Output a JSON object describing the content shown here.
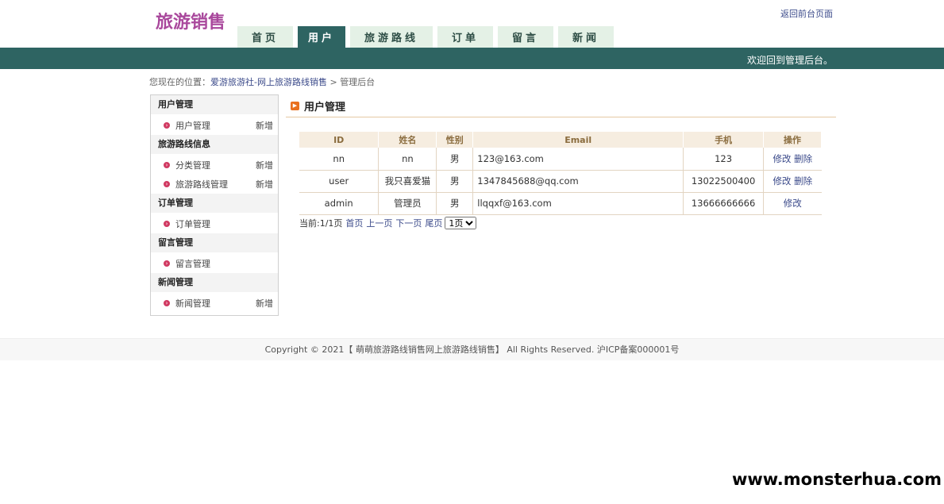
{
  "header": {
    "logo": "旅游销售",
    "back_link": "返回前台页面",
    "welcome": "欢迎回到管理后台。"
  },
  "nav": {
    "tabs": [
      {
        "label": "首页",
        "active": false
      },
      {
        "label": "用户",
        "active": true
      },
      {
        "label": "旅游路线",
        "active": false
      },
      {
        "label": "订单",
        "active": false
      },
      {
        "label": "留言",
        "active": false
      },
      {
        "label": "新闻",
        "active": false
      }
    ]
  },
  "breadcrumb": {
    "prefix": "您现在的位置：",
    "site": "爱游旅游社-网上旅游路线销售",
    "separator": ">",
    "current": "管理后台"
  },
  "sidebar": {
    "sections": [
      {
        "title": "用户管理",
        "items": [
          {
            "label": "用户管理",
            "add": "新增"
          }
        ]
      },
      {
        "title": "旅游路线信息",
        "items": [
          {
            "label": "分类管理",
            "add": "新增"
          },
          {
            "label": "旅游路线管理",
            "add": "新增"
          }
        ]
      },
      {
        "title": "订单管理",
        "items": [
          {
            "label": "订单管理",
            "add": ""
          }
        ]
      },
      {
        "title": "留言管理",
        "items": [
          {
            "label": "留言管理",
            "add": ""
          }
        ]
      },
      {
        "title": "新闻管理",
        "items": [
          {
            "label": "新闻管理",
            "add": "新增"
          }
        ]
      }
    ]
  },
  "main": {
    "title": "用户管理",
    "table": {
      "headers": [
        "ID",
        "姓名",
        "性别",
        "Email",
        "手机",
        "操作"
      ],
      "rows": [
        {
          "id": "nn",
          "name": "nn",
          "gender": "男",
          "email": "123@163.com",
          "phone": "123",
          "edit": "修改",
          "delete": "删除"
        },
        {
          "id": "user",
          "name": "我只喜爱猫",
          "gender": "男",
          "email": "1347845688@qq.com",
          "phone": "13022500400",
          "edit": "修改",
          "delete": "删除"
        },
        {
          "id": "admin",
          "name": "管理员",
          "gender": "男",
          "email": "llqqxf@163.com",
          "phone": "13666666666",
          "edit": "修改",
          "delete": ""
        }
      ]
    },
    "pager": {
      "status": "当前:1/1页",
      "first": "首页",
      "prev": "上一页",
      "next": "下一页",
      "last": "尾页",
      "select_value": "1页"
    }
  },
  "footer": {
    "text": "Copyright © 2021【 萌萌旅游路线销售网上旅游路线销售】 All Rights Reserved. 沪ICP备案000001号"
  },
  "watermark": "www.monsterhua.com"
}
